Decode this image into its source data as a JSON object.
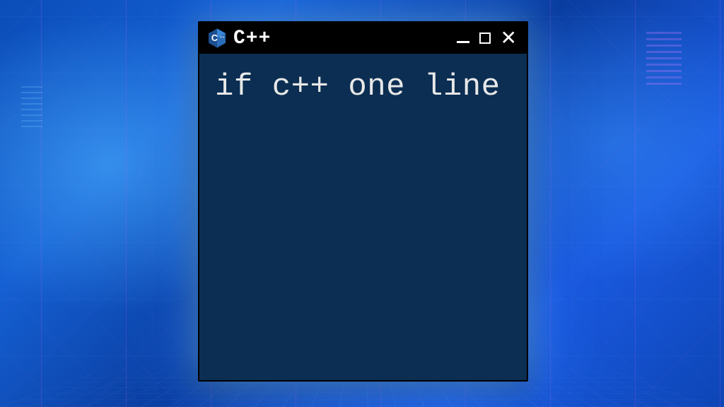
{
  "window": {
    "title": "C++",
    "icon_label": "cpp-icon"
  },
  "terminal": {
    "content": "if c++ one line"
  },
  "controls": {
    "minimize": "minimize",
    "maximize": "maximize",
    "close": "close"
  }
}
